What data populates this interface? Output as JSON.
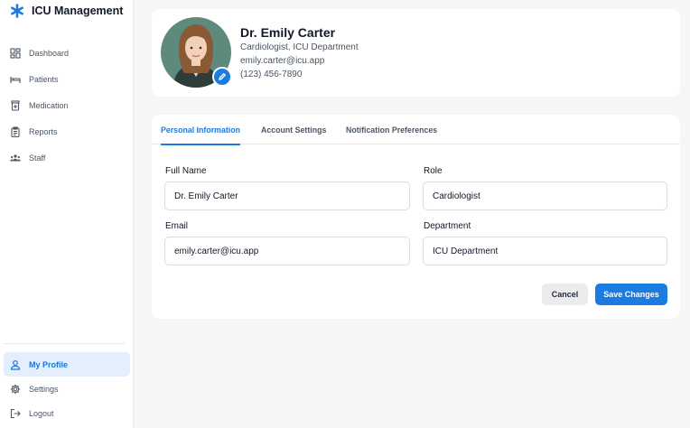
{
  "app": {
    "name": "ICU Management",
    "brand_icon": "asterisk-icon",
    "accent": "#1a7be0"
  },
  "sidebar": {
    "items": [
      {
        "label": "Dashboard",
        "icon": "dashboard-icon"
      },
      {
        "label": "Patients",
        "icon": "bed-icon"
      },
      {
        "label": "Medication",
        "icon": "medication-icon"
      },
      {
        "label": "Reports",
        "icon": "clipboard-icon"
      },
      {
        "label": "Staff",
        "icon": "staff-icon"
      }
    ],
    "bottom": [
      {
        "label": "My Profile",
        "icon": "user-icon",
        "active": true
      },
      {
        "label": "Settings",
        "icon": "gear-icon"
      },
      {
        "label": "Logout",
        "icon": "logout-icon"
      }
    ]
  },
  "profile": {
    "name": "Dr. Emily Carter",
    "title": "Cardiologist, ICU Department",
    "email": "emily.carter@icu.app",
    "phone": "(123) 456-7890"
  },
  "tabs": [
    {
      "label": "Personal Information",
      "active": true
    },
    {
      "label": "Account Settings"
    },
    {
      "label": "Notification Preferences"
    }
  ],
  "form": {
    "full_name": {
      "label": "Full Name",
      "value": "Dr. Emily Carter"
    },
    "role": {
      "label": "Role",
      "value": "Cardiologist"
    },
    "email": {
      "label": "Email",
      "value": "emily.carter@icu.app"
    },
    "department": {
      "label": "Department",
      "value": "ICU Department"
    },
    "cancel_label": "Cancel",
    "save_label": "Save Changes"
  }
}
